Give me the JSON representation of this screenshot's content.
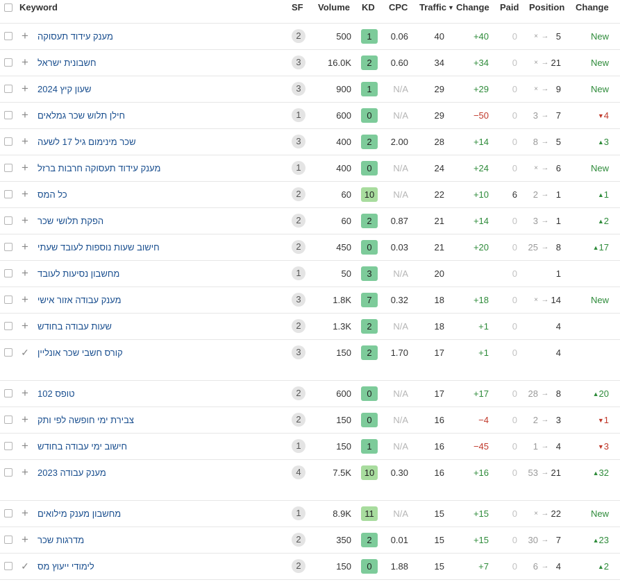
{
  "columns": {
    "keyword": "Keyword",
    "sf": "SF",
    "volume": "Volume",
    "kd": "KD",
    "cpc": "CPC",
    "traffic": "Traffic",
    "traffic_sort_icon": "caret-down-icon",
    "traffic_change": "Change",
    "paid": "Paid",
    "position": "Position",
    "position_change": "Change"
  },
  "colors": {
    "kd_low": "#7dcb9a",
    "kd_mid": "#a8dc9e",
    "positive": "#2e8b3a",
    "negative": "#c0392b",
    "link": "#1a4f8f"
  },
  "rows": [
    {
      "keyword": "מענק עידוד תעסוקה",
      "sf": "2",
      "volume": "500",
      "kd": "1",
      "cpc": "0.06",
      "traffic": "40",
      "change": "+40",
      "change_dir": "up",
      "paid": "0",
      "prev": "×",
      "position": "5",
      "pos_change": "New",
      "pos_dir": "new",
      "action": "add"
    },
    {
      "keyword": "חשבונית ישראל",
      "sf": "3",
      "volume": "16.0K",
      "kd": "2",
      "cpc": "0.60",
      "traffic": "34",
      "change": "+34",
      "change_dir": "up",
      "paid": "0",
      "prev": "×",
      "position": "21",
      "pos_change": "New",
      "pos_dir": "new",
      "action": "add"
    },
    {
      "keyword": "שעון קיץ 2024",
      "sf": "3",
      "volume": "900",
      "kd": "1",
      "cpc": "N/A",
      "traffic": "29",
      "change": "+29",
      "change_dir": "up",
      "paid": "0",
      "prev": "×",
      "position": "9",
      "pos_change": "New",
      "pos_dir": "new",
      "action": "add"
    },
    {
      "keyword": "חילן תלוש שכר גמלאים",
      "sf": "1",
      "volume": "600",
      "kd": "0",
      "cpc": "N/A",
      "traffic": "29",
      "change": "−50",
      "change_dir": "down",
      "paid": "0",
      "prev": "3",
      "position": "7",
      "pos_change": "4",
      "pos_dir": "down",
      "action": "add"
    },
    {
      "keyword": "שכר מינימום גיל 17 לשעה",
      "sf": "3",
      "volume": "400",
      "kd": "2",
      "cpc": "2.00",
      "traffic": "28",
      "change": "+14",
      "change_dir": "up",
      "paid": "0",
      "prev": "8",
      "position": "5",
      "pos_change": "3",
      "pos_dir": "up",
      "action": "add"
    },
    {
      "keyword": "מענק עידוד תעסוקה חרבות ברזל",
      "sf": "1",
      "volume": "400",
      "kd": "0",
      "cpc": "N/A",
      "traffic": "24",
      "change": "+24",
      "change_dir": "up",
      "paid": "0",
      "prev": "×",
      "position": "6",
      "pos_change": "New",
      "pos_dir": "new",
      "action": "add"
    },
    {
      "keyword": "כל המס",
      "sf": "2",
      "volume": "60",
      "kd": "10",
      "cpc": "N/A",
      "traffic": "22",
      "change": "+10",
      "change_dir": "up",
      "paid": "6",
      "prev": "2",
      "position": "1",
      "pos_change": "1",
      "pos_dir": "up",
      "action": "add"
    },
    {
      "keyword": "הפקת תלושי שכר",
      "sf": "2",
      "volume": "60",
      "kd": "2",
      "cpc": "0.87",
      "traffic": "21",
      "change": "+14",
      "change_dir": "up",
      "paid": "0",
      "prev": "3",
      "position": "1",
      "pos_change": "2",
      "pos_dir": "up",
      "action": "add"
    },
    {
      "keyword": "חישוב שעות נוספות לעובד שעתי",
      "sf": "2",
      "volume": "450",
      "kd": "0",
      "cpc": "0.03",
      "traffic": "21",
      "change": "+20",
      "change_dir": "up",
      "paid": "0",
      "prev": "25",
      "position": "8",
      "pos_change": "17",
      "pos_dir": "up",
      "action": "add"
    },
    {
      "keyword": "מחשבון נסיעות לעובד",
      "sf": "1",
      "volume": "50",
      "kd": "3",
      "cpc": "N/A",
      "traffic": "20",
      "change": "",
      "change_dir": "none",
      "paid": "0",
      "prev": "",
      "position": "1",
      "pos_change": "",
      "pos_dir": "none",
      "action": "add"
    },
    {
      "keyword": "מענק עבודה אזור אישי",
      "sf": "3",
      "volume": "1.8K",
      "kd": "7",
      "cpc": "0.32",
      "traffic": "18",
      "change": "+18",
      "change_dir": "up",
      "paid": "0",
      "prev": "×",
      "position": "14",
      "pos_change": "New",
      "pos_dir": "new",
      "action": "add"
    },
    {
      "keyword": "שעות עבודה בחודש",
      "sf": "2",
      "volume": "1.3K",
      "kd": "2",
      "cpc": "N/A",
      "traffic": "18",
      "change": "+1",
      "change_dir": "up",
      "paid": "0",
      "prev": "",
      "position": "4",
      "pos_change": "",
      "pos_dir": "none",
      "action": "add"
    },
    {
      "keyword": "קורס חשבי שכר אונליין",
      "sf": "3",
      "volume": "150",
      "kd": "2",
      "cpc": "1.70",
      "traffic": "17",
      "change": "+1",
      "change_dir": "up",
      "paid": "0",
      "prev": "",
      "position": "4",
      "pos_change": "",
      "pos_dir": "none",
      "action": "check",
      "tall": true
    },
    {
      "keyword": "טופס 102",
      "sf": "2",
      "volume": "600",
      "kd": "0",
      "cpc": "N/A",
      "traffic": "17",
      "change": "+17",
      "change_dir": "up",
      "paid": "0",
      "prev": "28",
      "position": "8",
      "pos_change": "20",
      "pos_dir": "up",
      "action": "add"
    },
    {
      "keyword": "צבירת ימי חופשה לפי ותק",
      "sf": "2",
      "volume": "150",
      "kd": "0",
      "cpc": "N/A",
      "traffic": "16",
      "change": "−4",
      "change_dir": "down",
      "paid": "0",
      "prev": "2",
      "position": "3",
      "pos_change": "1",
      "pos_dir": "down",
      "action": "add"
    },
    {
      "keyword": "חישוב ימי עבודה בחודש",
      "sf": "1",
      "volume": "150",
      "kd": "1",
      "cpc": "N/A",
      "traffic": "16",
      "change": "−45",
      "change_dir": "down",
      "paid": "0",
      "prev": "1",
      "position": "4",
      "pos_change": "3",
      "pos_dir": "down",
      "action": "add"
    },
    {
      "keyword": "מענק עבודה 2023",
      "sf": "4",
      "volume": "7.5K",
      "kd": "10",
      "cpc": "0.30",
      "traffic": "16",
      "change": "+16",
      "change_dir": "up",
      "paid": "0",
      "prev": "53",
      "position": "21",
      "pos_change": "32",
      "pos_dir": "up",
      "action": "add",
      "tall": true
    },
    {
      "keyword": "מחשבון מענק מילואים",
      "sf": "1",
      "volume": "8.9K",
      "kd": "11",
      "cpc": "N/A",
      "traffic": "15",
      "change": "+15",
      "change_dir": "up",
      "paid": "0",
      "prev": "×",
      "position": "22",
      "pos_change": "New",
      "pos_dir": "new",
      "action": "add"
    },
    {
      "keyword": "מדרגות שכר",
      "sf": "2",
      "volume": "350",
      "kd": "2",
      "cpc": "0.01",
      "traffic": "15",
      "change": "+15",
      "change_dir": "up",
      "paid": "0",
      "prev": "30",
      "position": "7",
      "pos_change": "23",
      "pos_dir": "up",
      "action": "add"
    },
    {
      "keyword": "לימודי ייעוץ מס",
      "sf": "2",
      "volume": "150",
      "kd": "0",
      "cpc": "1.88",
      "traffic": "15",
      "change": "+7",
      "change_dir": "up",
      "paid": "0",
      "prev": "6",
      "position": "4",
      "pos_change": "2",
      "pos_dir": "up",
      "action": "check"
    }
  ]
}
